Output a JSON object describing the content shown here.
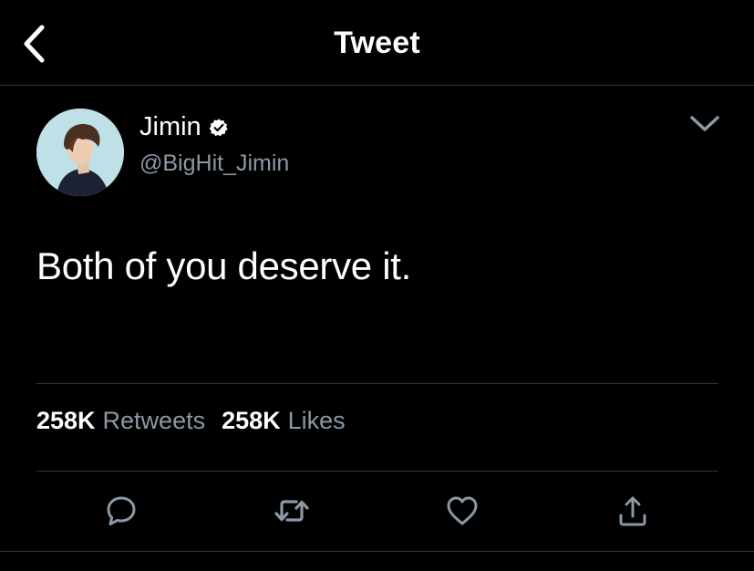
{
  "header": {
    "title": "Tweet",
    "back_icon": "chevron-left-icon"
  },
  "tweet": {
    "author": {
      "display_name": "Jimin",
      "handle": "@BigHit_Jimin",
      "verified": true,
      "avatar": "profile-photo"
    },
    "text": "Both of you deserve it.",
    "menu_icon": "chevron-down-icon"
  },
  "stats": {
    "retweets_count": "258K",
    "retweets_label": "Retweets",
    "likes_count": "258K",
    "likes_label": "Likes"
  },
  "actions": [
    {
      "name": "reply",
      "icon": "reply-icon"
    },
    {
      "name": "retweet",
      "icon": "retweet-icon"
    },
    {
      "name": "like",
      "icon": "heart-icon"
    },
    {
      "name": "share",
      "icon": "share-icon"
    }
  ],
  "colors": {
    "background": "#000000",
    "primary_text": "#ffffff",
    "secondary_text": "#8b98a5",
    "divider": "#2f3336",
    "icon": "#8b98a5"
  }
}
